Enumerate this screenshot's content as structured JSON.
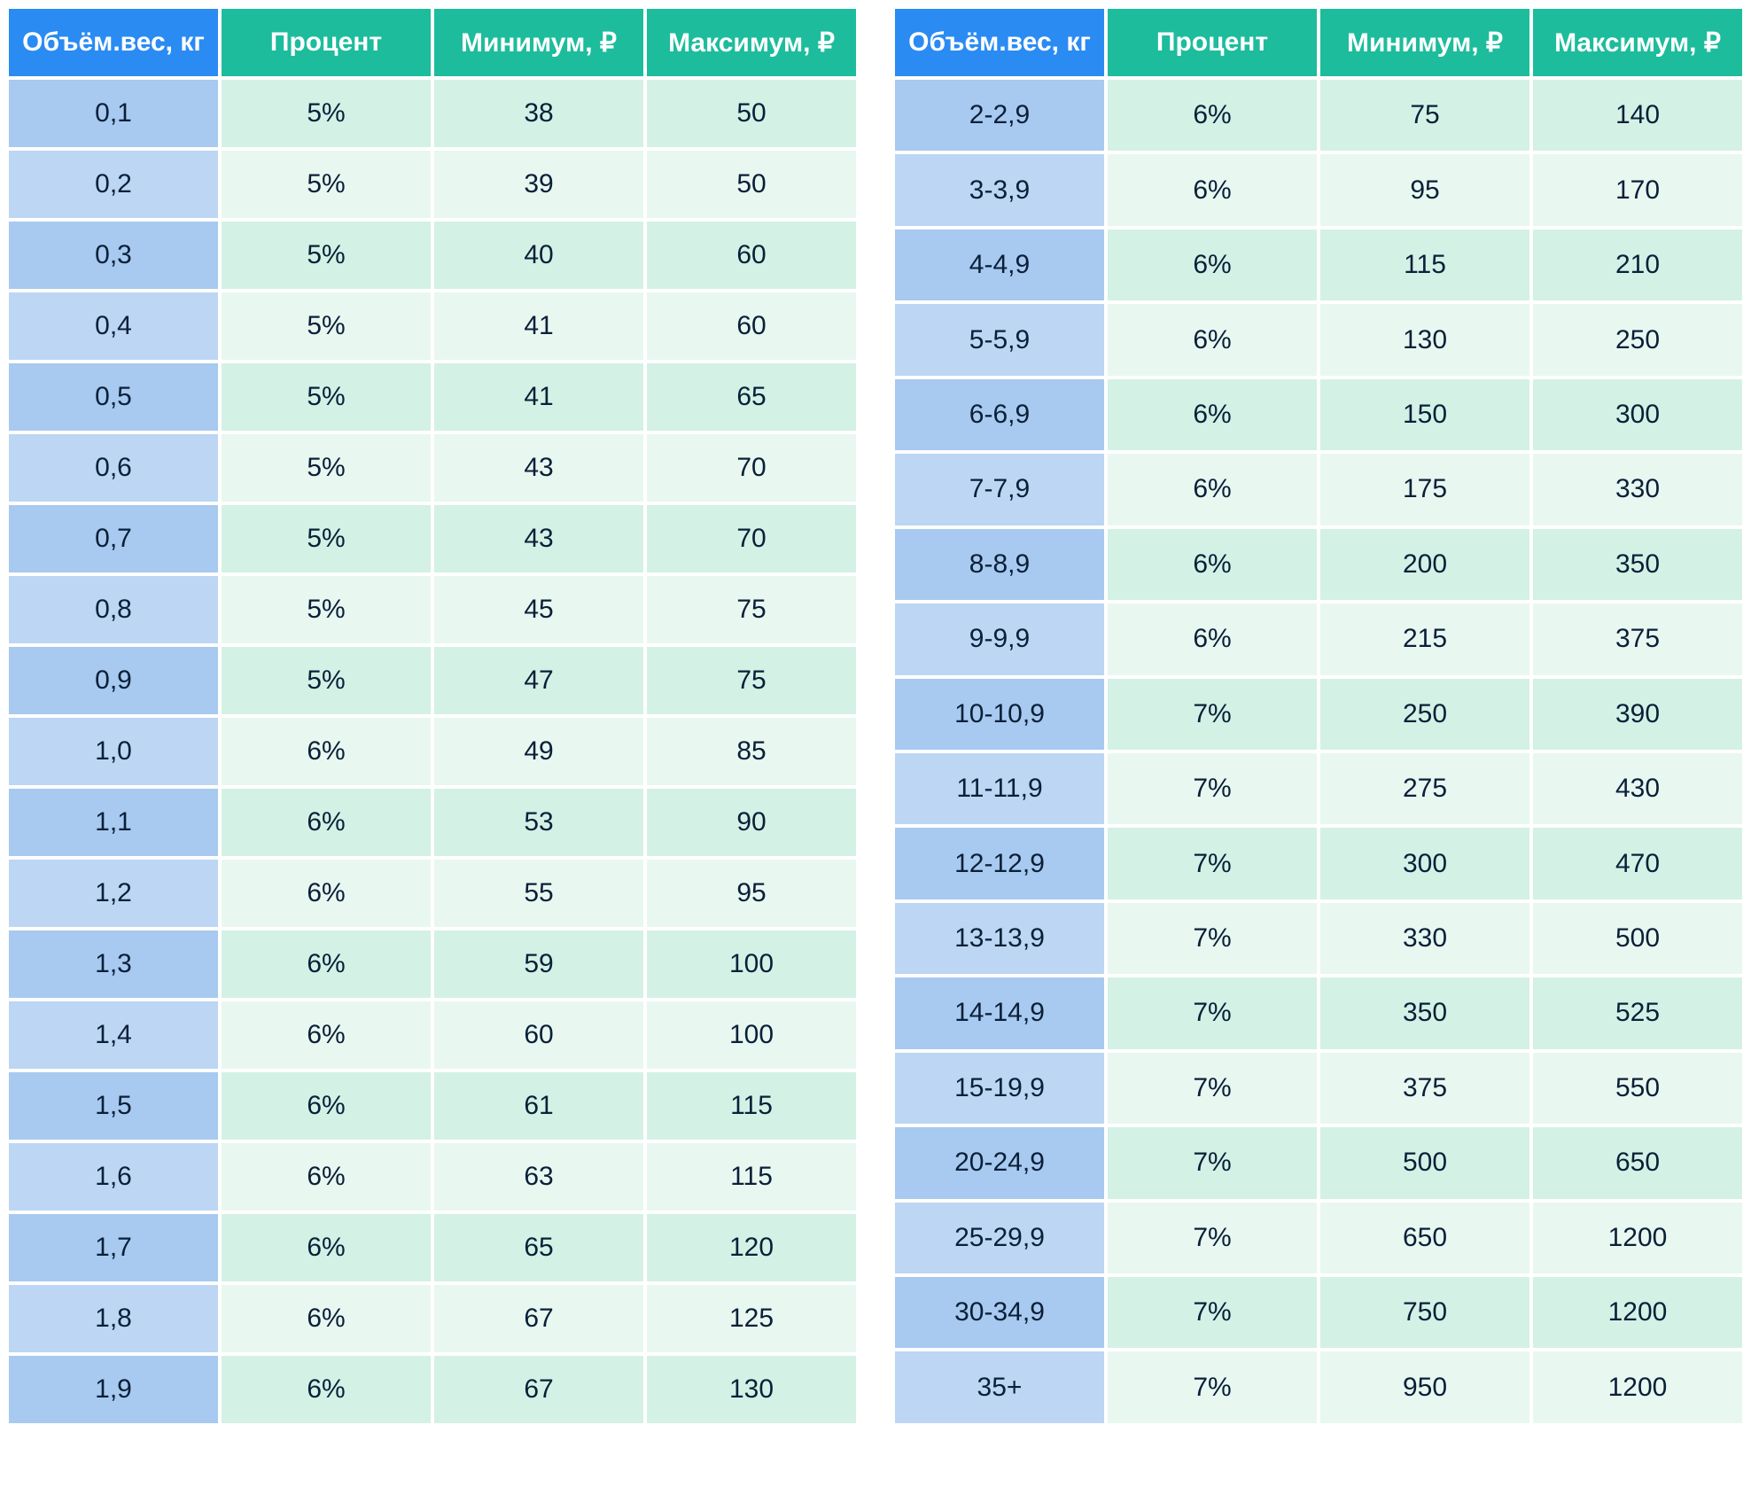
{
  "headers": {
    "weight": "Объём.вес, кг",
    "percent": "Процент",
    "min": "Минимум, ₽",
    "max": "Максимум, ₽"
  },
  "tables": [
    {
      "rows": [
        {
          "weight": "0,1",
          "percent": "5%",
          "min": "38",
          "max": "50"
        },
        {
          "weight": "0,2",
          "percent": "5%",
          "min": "39",
          "max": "50"
        },
        {
          "weight": "0,3",
          "percent": "5%",
          "min": "40",
          "max": "60"
        },
        {
          "weight": "0,4",
          "percent": "5%",
          "min": "41",
          "max": "60"
        },
        {
          "weight": "0,5",
          "percent": "5%",
          "min": "41",
          "max": "65"
        },
        {
          "weight": "0,6",
          "percent": "5%",
          "min": "43",
          "max": "70"
        },
        {
          "weight": "0,7",
          "percent": "5%",
          "min": "43",
          "max": "70"
        },
        {
          "weight": "0,8",
          "percent": "5%",
          "min": "45",
          "max": "75"
        },
        {
          "weight": "0,9",
          "percent": "5%",
          "min": "47",
          "max": "75"
        },
        {
          "weight": "1,0",
          "percent": "6%",
          "min": "49",
          "max": "85"
        },
        {
          "weight": "1,1",
          "percent": "6%",
          "min": "53",
          "max": "90"
        },
        {
          "weight": "1,2",
          "percent": "6%",
          "min": "55",
          "max": "95"
        },
        {
          "weight": "1,3",
          "percent": "6%",
          "min": "59",
          "max": "100"
        },
        {
          "weight": "1,4",
          "percent": "6%",
          "min": "60",
          "max": "100"
        },
        {
          "weight": "1,5",
          "percent": "6%",
          "min": "61",
          "max": "115"
        },
        {
          "weight": "1,6",
          "percent": "6%",
          "min": "63",
          "max": "115"
        },
        {
          "weight": "1,7",
          "percent": "6%",
          "min": "65",
          "max": "120"
        },
        {
          "weight": "1,8",
          "percent": "6%",
          "min": "67",
          "max": "125"
        },
        {
          "weight": "1,9",
          "percent": "6%",
          "min": "67",
          "max": "130"
        }
      ]
    },
    {
      "rows": [
        {
          "weight": "2-2,9",
          "percent": "6%",
          "min": "75",
          "max": "140"
        },
        {
          "weight": "3-3,9",
          "percent": "6%",
          "min": "95",
          "max": "170"
        },
        {
          "weight": "4-4,9",
          "percent": "6%",
          "min": "115",
          "max": "210"
        },
        {
          "weight": "5-5,9",
          "percent": "6%",
          "min": "130",
          "max": "250"
        },
        {
          "weight": "6-6,9",
          "percent": "6%",
          "min": "150",
          "max": "300"
        },
        {
          "weight": "7-7,9",
          "percent": "6%",
          "min": "175",
          "max": "330"
        },
        {
          "weight": "8-8,9",
          "percent": "6%",
          "min": "200",
          "max": "350"
        },
        {
          "weight": "9-9,9",
          "percent": "6%",
          "min": "215",
          "max": "375"
        },
        {
          "weight": "10-10,9",
          "percent": "7%",
          "min": "250",
          "max": "390"
        },
        {
          "weight": "11-11,9",
          "percent": "7%",
          "min": "275",
          "max": "430"
        },
        {
          "weight": "12-12,9",
          "percent": "7%",
          "min": "300",
          "max": "470"
        },
        {
          "weight": "13-13,9",
          "percent": "7%",
          "min": "330",
          "max": "500"
        },
        {
          "weight": "14-14,9",
          "percent": "7%",
          "min": "350",
          "max": "525"
        },
        {
          "weight": "15-19,9",
          "percent": "7%",
          "min": "375",
          "max": "550"
        },
        {
          "weight": "20-24,9",
          "percent": "7%",
          "min": "500",
          "max": "650"
        },
        {
          "weight": "25-29,9",
          "percent": "7%",
          "min": "650",
          "max": "1200"
        },
        {
          "weight": "30-34,9",
          "percent": "7%",
          "min": "750",
          "max": "1200"
        },
        {
          "weight": "35+",
          "percent": "7%",
          "min": "950",
          "max": "1200"
        }
      ]
    }
  ]
}
